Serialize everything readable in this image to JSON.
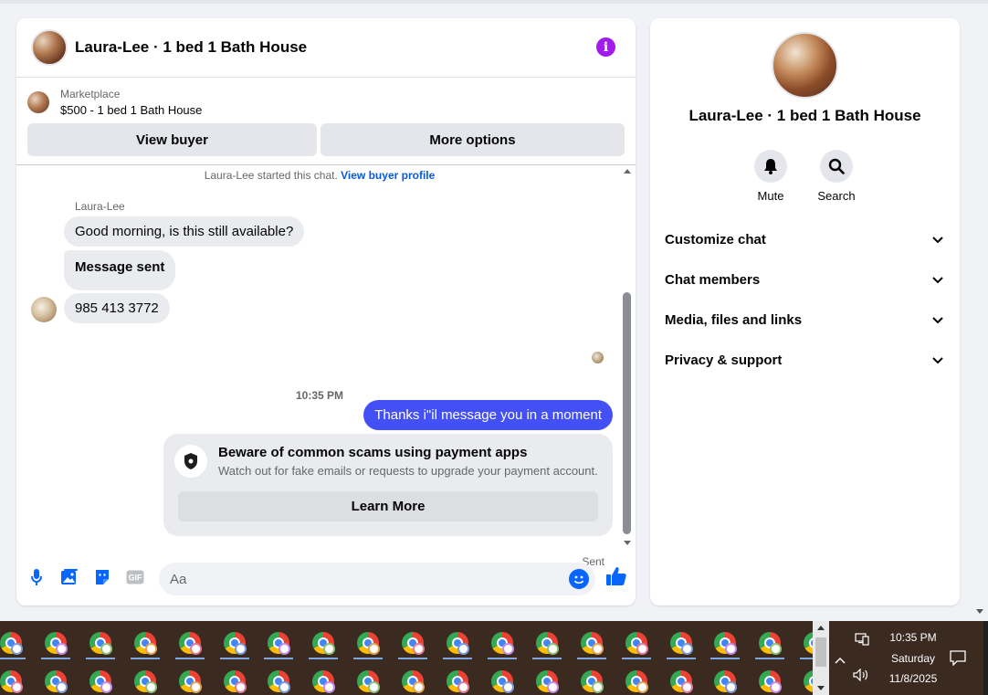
{
  "chat": {
    "title": "Laura-Lee · 1 bed 1 Bath House",
    "marketplace_label": "Marketplace",
    "listing": "$500 - 1 bed 1 Bath House",
    "view_buyer": "View buyer",
    "more_options": "More options",
    "started_text": "Laura-Lee started this chat.",
    "view_profile": "View buyer profile",
    "sender": "Laura-Lee",
    "messages": [
      {
        "text": "Good morning, is this still available?"
      },
      {
        "text": "Message sent"
      },
      {
        "text": "985 413 3772"
      }
    ],
    "time_separator": "10:35 PM",
    "outgoing": "Thanks i\"il message you in a moment",
    "scam": {
      "title": "Beware of common scams using payment apps",
      "subtitle": "Watch out for fake emails or requests to upgrade your payment account.",
      "button": "Learn More"
    },
    "sent_label": "Sent",
    "composer_placeholder": "Aa",
    "gif_label": "GIF"
  },
  "info_panel": {
    "title": "Laura-Lee · 1 bed 1 Bath House",
    "actions": [
      {
        "label": "Mute",
        "icon": "bell-icon"
      },
      {
        "label": "Search",
        "icon": "search-icon"
      }
    ],
    "sections": [
      {
        "label": "Customize chat"
      },
      {
        "label": "Chat members"
      },
      {
        "label": "Media, files and links"
      },
      {
        "label": "Privacy & support"
      }
    ]
  },
  "taskbar": {
    "time": "10:35 PM",
    "day": "Saturday",
    "date": "11/8/2025",
    "app_icon": "chrome-icon"
  },
  "colors": {
    "accent": "#0866ff",
    "outgoing_bubble": "#4350f5",
    "info_icon": "#a31be8",
    "link": "#0a5ad6"
  }
}
